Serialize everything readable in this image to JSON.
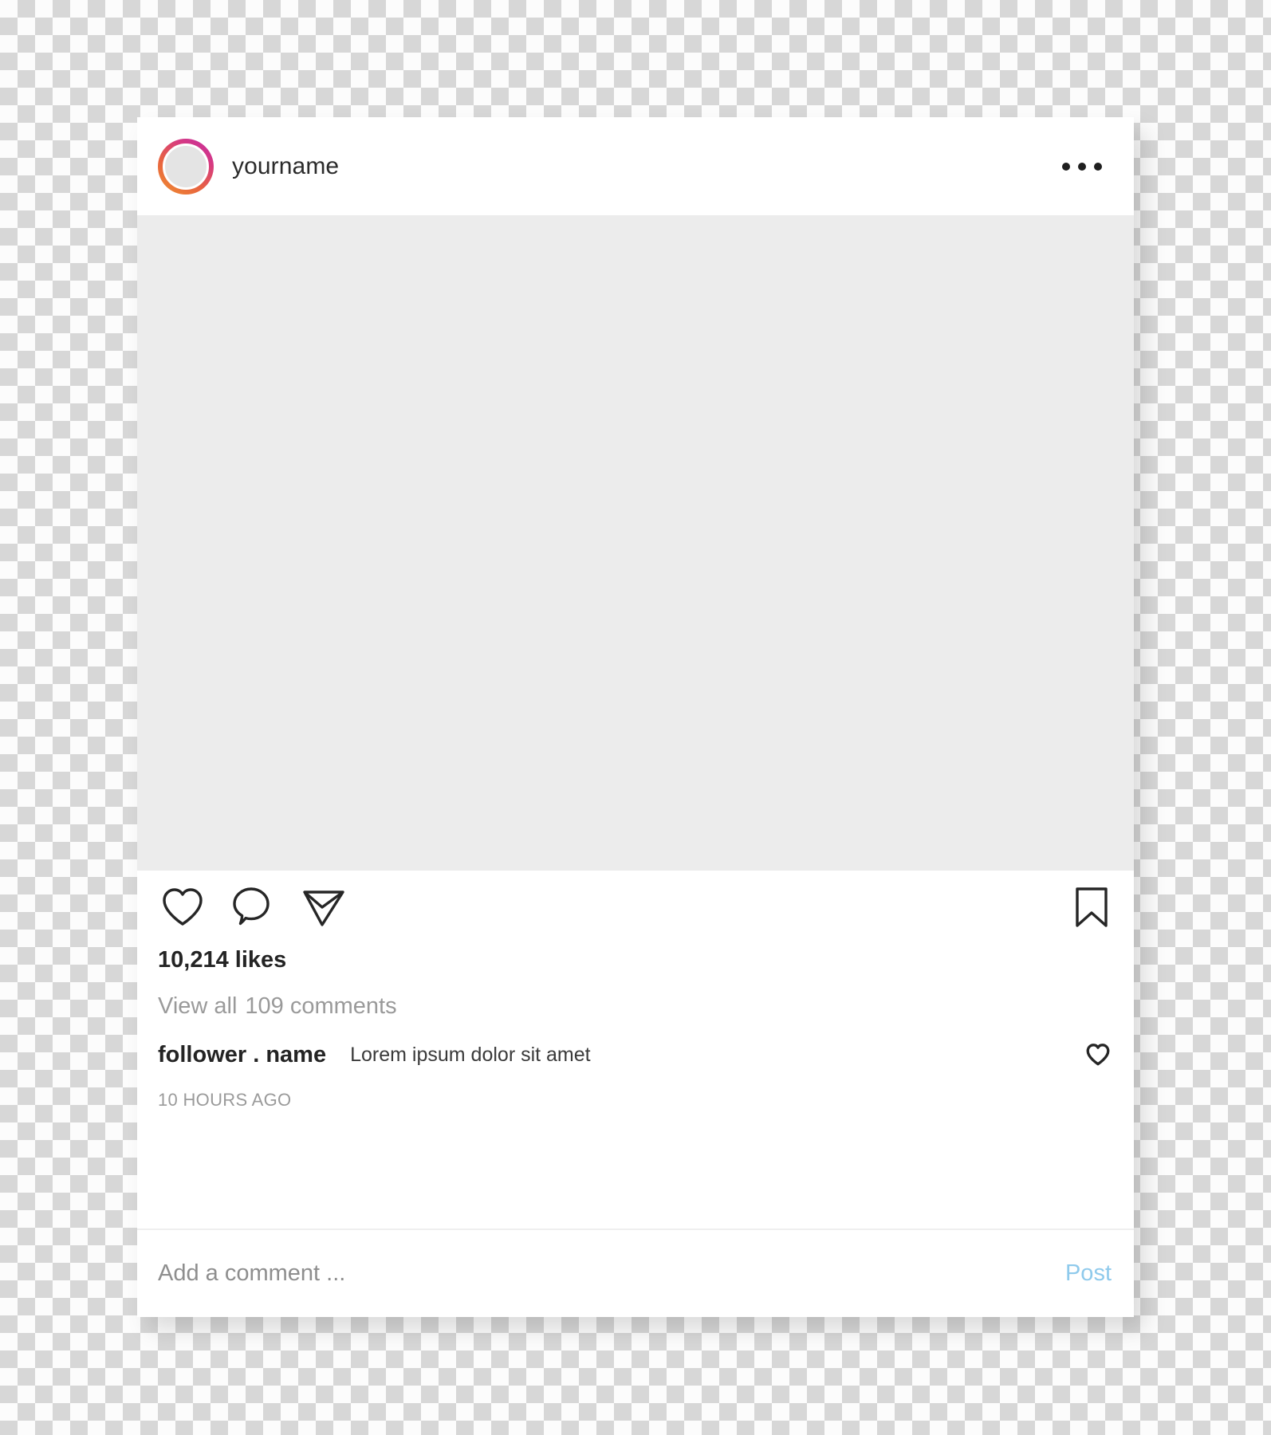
{
  "background": {
    "type": "transparency-checkerboard",
    "light_color": "#fcfcfc",
    "dark_color": "#d7d7d7"
  },
  "card": {
    "background_color": "#ffffff",
    "header": {
      "username": "yourname",
      "avatar_icon": "avatar-placeholder",
      "avatar_ring_colors": [
        "#c32aa3",
        "#d63a82",
        "#e8633f",
        "#ef8f32"
      ],
      "more_options_icon": "ellipsis-icon"
    },
    "media": {
      "placeholder_color": "#ececec",
      "alt": ""
    },
    "actions": {
      "like_icon": "heart-icon",
      "comment_icon": "speech-bubble-icon",
      "share_icon": "paper-plane-icon",
      "save_icon": "bookmark-icon"
    },
    "meta": {
      "likes": "10,214 likes",
      "view_all_label": "View all",
      "comments_count_label": "109 comments",
      "comment_author": "follower . name",
      "comment_body": "Lorem ipsum dolor sit amet",
      "comment_like_icon": "heart-icon-small",
      "timestamp": "10 HOURS AGO"
    },
    "add_comment": {
      "placeholder": "Add a comment ...",
      "value": "",
      "post_label": "Post",
      "post_color": "#8fcaec"
    }
  }
}
